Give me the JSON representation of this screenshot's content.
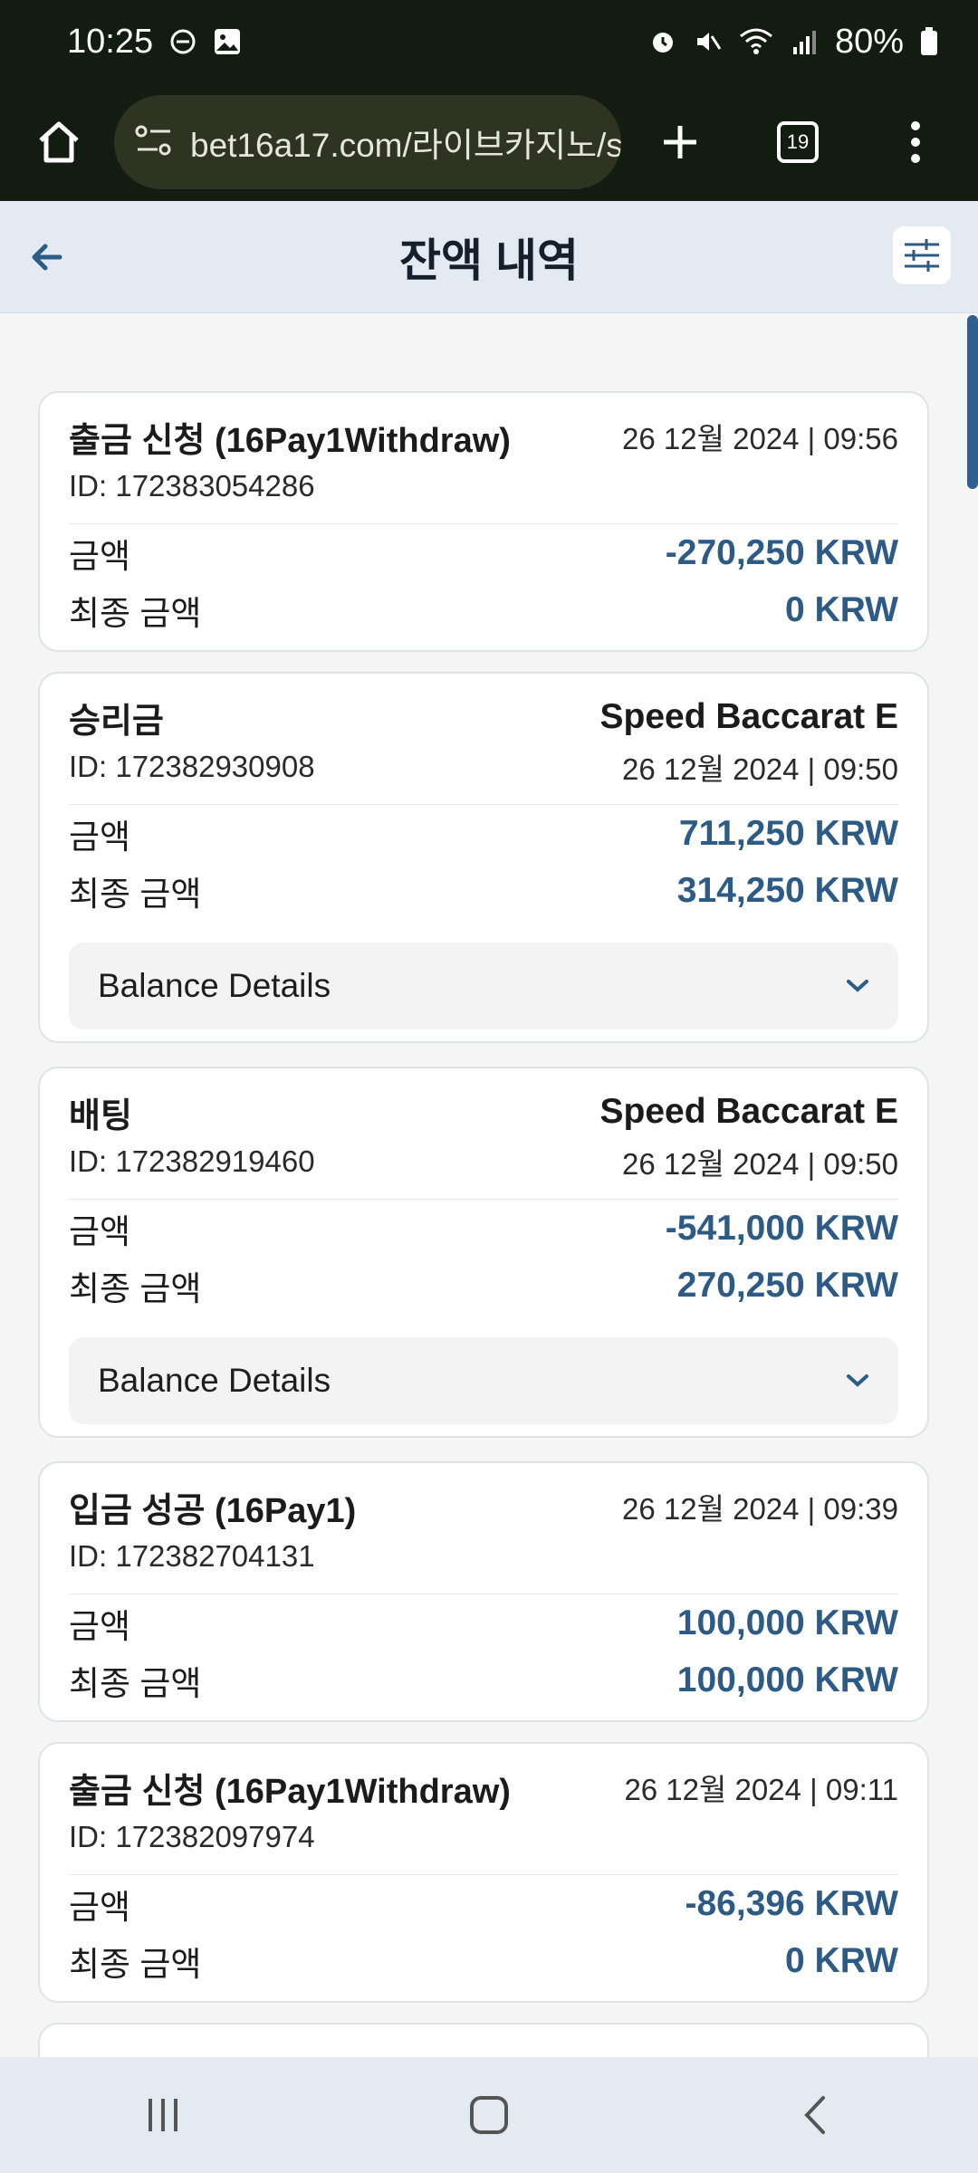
{
  "status_bar": {
    "time": "10:25",
    "battery": "80%"
  },
  "browser": {
    "url": "bet16a17.com/라이브카지노/s",
    "tab_count": "19"
  },
  "header": {
    "title": "잔액 내역"
  },
  "labels": {
    "amount": "금액",
    "final_amount": "최종 금액",
    "balance_details": "Balance Details"
  },
  "transactions": [
    {
      "type": "출금 신청 (16Pay1Withdraw)",
      "game": "",
      "id": "ID: 172383054286",
      "date": "26 12월 2024 | 09:56",
      "amount": "-270,250 KRW",
      "final_amount": "0 KRW"
    },
    {
      "type": "승리금",
      "game": "Speed Baccarat E",
      "id": "ID: 172382930908",
      "date": "26 12월 2024 | 09:50",
      "amount": "711,250 KRW",
      "final_amount": "314,250 KRW"
    },
    {
      "type": "배팅",
      "game": "Speed Baccarat E",
      "id": "ID: 172382919460",
      "date": "26 12월 2024 | 09:50",
      "amount": "-541,000 KRW",
      "final_amount": "270,250 KRW"
    },
    {
      "type": "입금 성공 (16Pay1)",
      "game": "",
      "id": "ID: 172382704131",
      "date": "26 12월 2024 | 09:39",
      "amount": "100,000 KRW",
      "final_amount": "100,000 KRW"
    },
    {
      "type": "출금 신청 (16Pay1Withdraw)",
      "game": "",
      "id": "ID: 172382097974",
      "date": "26 12월 2024 | 09:11",
      "amount": "-86,396 KRW",
      "final_amount": "0 KRW"
    }
  ],
  "colors": {
    "amount_accent": "#2d5b86",
    "header_bg": "#e3eaf2",
    "statusbar_bg": "#131c10"
  }
}
